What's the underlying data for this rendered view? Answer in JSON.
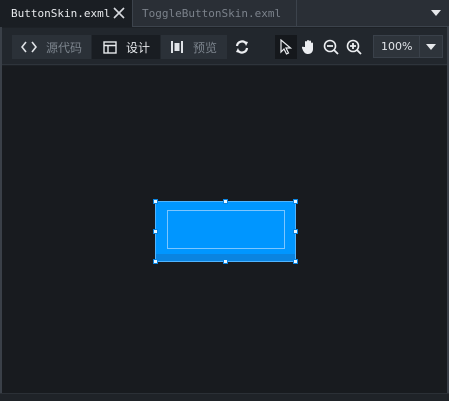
{
  "tabs": [
    {
      "label": "ButtonSkin.exml",
      "active": true
    },
    {
      "label": "ToggleButtonSkin.exml",
      "active": false
    }
  ],
  "toolbar": {
    "view_modes": [
      {
        "label": "源代码",
        "icon": "code-icon",
        "selected": false
      },
      {
        "label": "设计",
        "icon": "layout-icon",
        "selected": true
      },
      {
        "label": "预览",
        "icon": "preview-icon",
        "selected": false
      }
    ],
    "tools": [
      "refresh-icon",
      "select-pointer-icon",
      "hand-pan-icon",
      "zoom-out-icon",
      "zoom-in-icon"
    ],
    "zoom": {
      "value": "100%"
    }
  },
  "colors": {
    "accent": "#0096ff",
    "background": "#181b1f"
  }
}
